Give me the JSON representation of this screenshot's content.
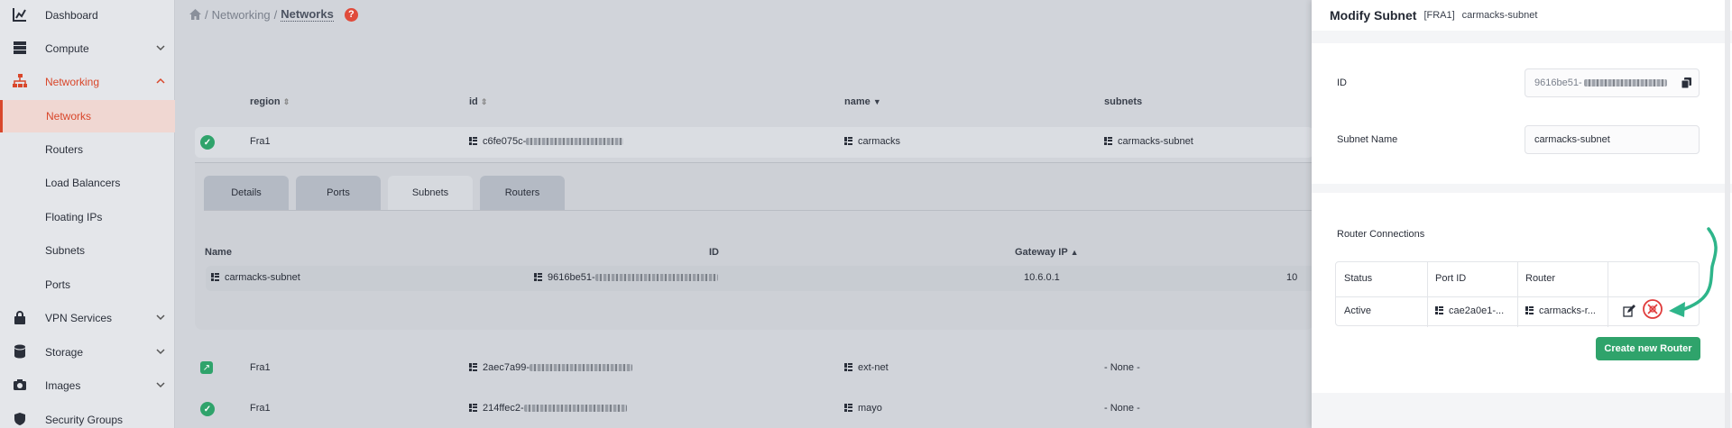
{
  "sidebar": {
    "items": [
      {
        "label": "Dashboard",
        "icon": "chart-icon",
        "chevron": false
      },
      {
        "label": "Compute",
        "icon": "server-icon",
        "chevron": true
      },
      {
        "label": "Networking",
        "icon": "network-icon",
        "chevron": true,
        "expanded": true
      },
      {
        "label": "Networks",
        "sub": true,
        "active": true
      },
      {
        "label": "Routers",
        "sub": true
      },
      {
        "label": "Load Balancers",
        "sub": true
      },
      {
        "label": "Floating IPs",
        "sub": true
      },
      {
        "label": "Subnets",
        "sub": true
      },
      {
        "label": "Ports",
        "sub": true
      },
      {
        "label": "VPN Services",
        "icon": "lock-icon",
        "chevron": true
      },
      {
        "label": "Storage",
        "icon": "database-icon",
        "chevron": true
      },
      {
        "label": "Images",
        "icon": "camera-icon",
        "chevron": true
      },
      {
        "label": "Security Groups",
        "icon": "shield-icon",
        "chevron": false
      }
    ]
  },
  "breadcrumb": {
    "sep": "/",
    "level1": "Networking",
    "current": "Networks",
    "help": "?"
  },
  "table": {
    "headers": {
      "region": "region",
      "id": "id",
      "name": "name",
      "subnets": "subnets"
    },
    "rows": [
      {
        "region": "Fra1",
        "id_prefix": "c6fe075c-",
        "name": "carmacks",
        "subnets": "carmacks-subnet",
        "status": "ok"
      },
      {
        "region": "Fra1",
        "id_prefix": "2aec7a99-",
        "name": "ext-net",
        "subnets": "- None -",
        "status": "external"
      },
      {
        "region": "Fra1",
        "id_prefix": "214ffec2-",
        "name": "mayo",
        "subnets": "- None -",
        "status": "ok"
      }
    ]
  },
  "detail": {
    "tabs": [
      "Details",
      "Ports",
      "Subnets",
      "Routers"
    ],
    "active_tab": "Subnets",
    "subnet_headers": {
      "name": "Name",
      "id": "ID",
      "gateway": "Gateway IP"
    },
    "subnet_row": {
      "name": "carmacks-subnet",
      "id_prefix": "9616be51-",
      "gateway": "10.6.0.1",
      "extra": "10"
    }
  },
  "drawer": {
    "title": "Modify Subnet",
    "region": "[FRA1]",
    "subnet": "carmacks-subnet",
    "id_label": "ID",
    "id_value": "9616be51-",
    "name_label": "Subnet Name",
    "name_value": "carmacks-subnet",
    "router_connections_label": "Router Connections",
    "rc_headers": {
      "status": "Status",
      "port": "Port ID",
      "router": "Router"
    },
    "rc_row": {
      "status": "Active",
      "port": "cae2a0e1-...",
      "router": "carmacks-r..."
    },
    "create_button": "Create new Router"
  },
  "colors": {
    "accent": "#d9472b",
    "success": "#2fa36b",
    "annotation": "#2eb58a",
    "danger": "#e03c3c"
  }
}
